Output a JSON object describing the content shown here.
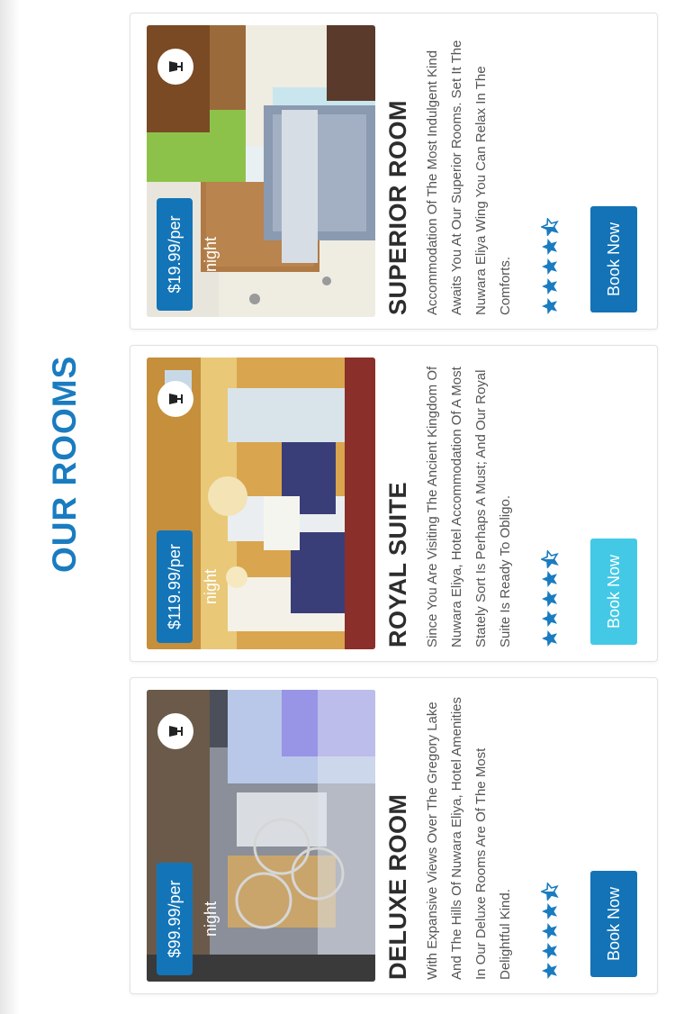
{
  "section": {
    "title": "OUR ROOMS"
  },
  "rooms": [
    {
      "name": "SUPERIOR ROOM",
      "price": "$19.99/per night",
      "description": "Accommodation Of The Most Indulgent Kind Awaits You At Our Superior Rooms. Set It The Nuwara Eliya Wing You Can Relax In The Comforts.",
      "rating": 4.5,
      "button": "Book Now",
      "button_color": "#1373b6",
      "lamp_icon": "lamp-icon"
    },
    {
      "name": "ROYAL SUITE",
      "price": "$119.99/per night",
      "description": "Since You Are Visiting The Ancient Kingdom Of Nuwara Eliya, Hotel Accommodation Of A Most Stately Sort Is Perhaps A Must; And Our Royal Suite Is Ready To Obligo.",
      "rating": 4.5,
      "button": "Book Now",
      "button_color": "#43c9e6",
      "lamp_icon": "lamp-icon"
    },
    {
      "name": "DELUXE ROOM",
      "price": "$99.99/per night",
      "description": "With Expansive Views Over The Gregory Lake And The Hills Of Nuwara Eliya, Hotel Amenities In Our Deluxe Rooms Are Of The Most Delightful Kind.",
      "rating": 4.5,
      "button": "Book Now",
      "button_color": "#1373b6",
      "lamp_icon": "lamp-icon"
    }
  ],
  "colors": {
    "accent": "#1a7cc0",
    "price_badge": "#1375b8",
    "star": "#1a7cc0"
  }
}
